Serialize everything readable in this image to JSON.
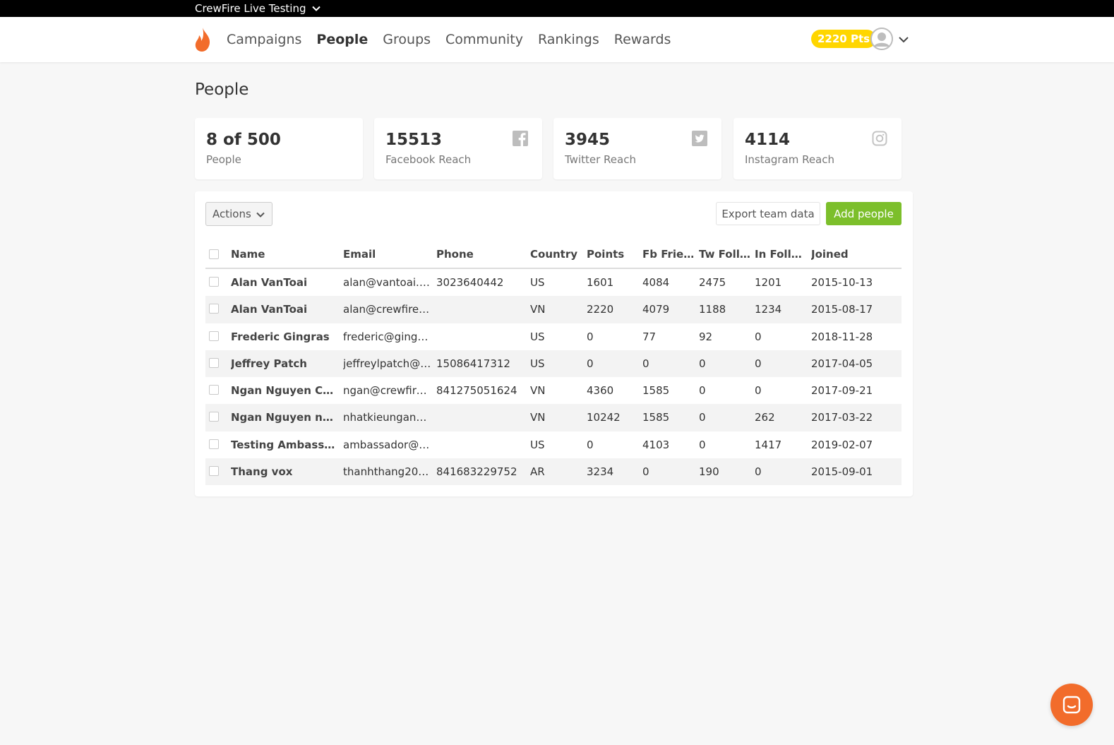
{
  "org": {
    "name": "CrewFire Live Testing"
  },
  "nav": {
    "items": [
      {
        "label": "Campaigns",
        "active": false
      },
      {
        "label": "People",
        "active": true
      },
      {
        "label": "Groups",
        "active": false
      },
      {
        "label": "Community",
        "active": false
      },
      {
        "label": "Rankings",
        "active": false
      },
      {
        "label": "Rewards",
        "active": false
      }
    ],
    "points": "2220 Pts"
  },
  "page": {
    "title": "People"
  },
  "stats": [
    {
      "value": "8 of 500",
      "label": "People",
      "icon": ""
    },
    {
      "value": "15513",
      "label": "Facebook Reach",
      "icon": "facebook-icon"
    },
    {
      "value": "3945",
      "label": "Twitter Reach",
      "icon": "twitter-icon"
    },
    {
      "value": "4114",
      "label": "Instagram Reach",
      "icon": "instagram-icon"
    }
  ],
  "toolbar": {
    "actions_label": "Actions",
    "export_label": "Export team data",
    "add_label": "Add people"
  },
  "table": {
    "columns": [
      "Name",
      "Email",
      "Phone",
      "Country",
      "Points",
      "Fb Frie…",
      "Tw Foll…",
      "In Foll…",
      "Joined"
    ],
    "rows": [
      [
        "Alan VanToai",
        "alan@vantoai.c…",
        "3023640442",
        "US",
        "1601",
        "4084",
        "2475",
        "1201",
        "2015-10-13"
      ],
      [
        "Alan VanToai",
        "alan@crewfire.…",
        "",
        "VN",
        "2220",
        "4079",
        "1188",
        "1234",
        "2015-08-17"
      ],
      [
        "Frederic Gingras",
        "frederic@gingr…",
        "",
        "US",
        "0",
        "77",
        "92",
        "0",
        "2018-11-28"
      ],
      [
        "Jeffrey Patch",
        "jeffreylpatch@…",
        "15086417312",
        "US",
        "0",
        "0",
        "0",
        "0",
        "2017-04-05"
      ],
      [
        "Ngan Nguyen Cre…",
        "ngan@crewfire…",
        "841275051624",
        "VN",
        "4360",
        "1585",
        "0",
        "0",
        "2017-09-21"
      ],
      [
        "Ngan Nguyen nha…",
        "nhatkieungann…",
        "",
        "VN",
        "10242",
        "1585",
        "0",
        "262",
        "2017-03-22"
      ],
      [
        "Testing Ambassa…",
        "ambassador@v…",
        "",
        "US",
        "0",
        "4103",
        "0",
        "1417",
        "2019-02-07"
      ],
      [
        "Thang vox",
        "thanhthang20…",
        "841683229752",
        "AR",
        "3234",
        "0",
        "190",
        "0",
        "2015-09-01"
      ]
    ]
  },
  "colors": {
    "accent": "#7cbf2b",
    "brand": "#f26c2b",
    "points_badge": "#ffd600"
  }
}
